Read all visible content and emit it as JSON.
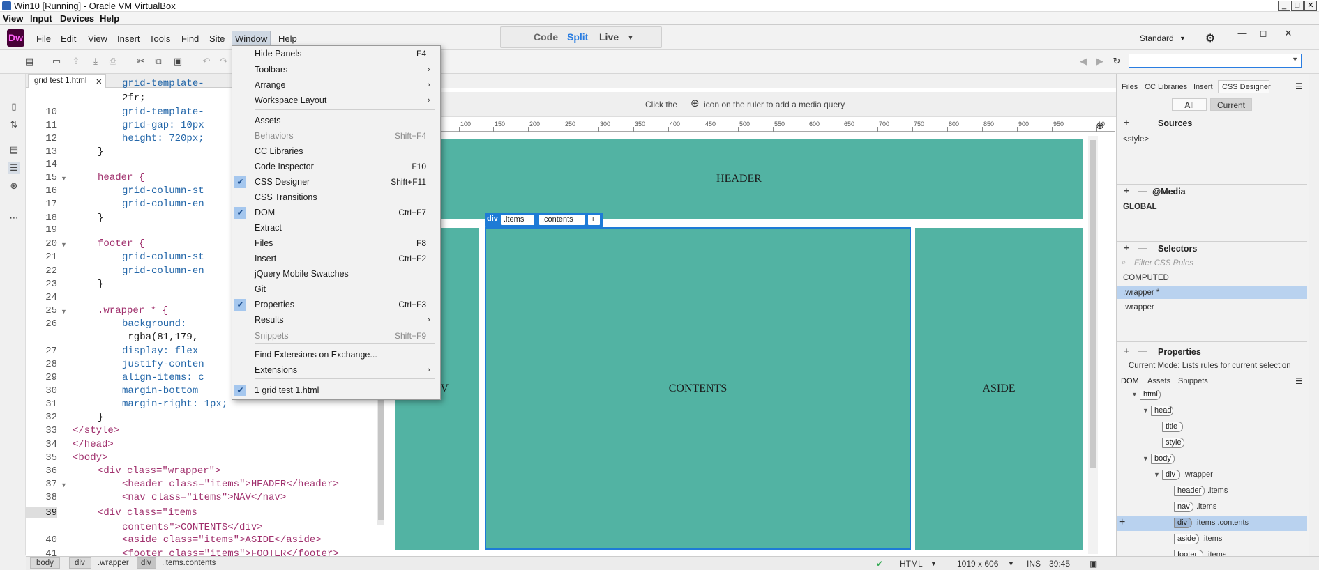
{
  "vbox": {
    "title": "Win10 [Running] - Oracle VM VirtualBox",
    "menu": [
      "View",
      "Input",
      "Devices",
      "Help"
    ]
  },
  "dw": {
    "logo": "Dw",
    "menu": [
      "File",
      "Edit",
      "View",
      "Insert",
      "Tools",
      "Find",
      "Site",
      "Window",
      "Help"
    ],
    "views": {
      "code": "Code",
      "split": "Split",
      "live": "Live"
    },
    "workspace": "Standard"
  },
  "document": {
    "tab": "grid test 1.html"
  },
  "code": {
    "lines": [
      {
        "n": "",
        "text": "grid-template-",
        "cls": "prop"
      },
      {
        "n": "",
        "text": "2fr;"
      },
      {
        "n": "10",
        "text": "grid-template-",
        "cls": "prop"
      },
      {
        "n": "11",
        "text": "grid-gap: 10px",
        "cls": "prop"
      },
      {
        "n": "12",
        "text": "height: 720px;",
        "cls": "prop"
      },
      {
        "n": "13",
        "text": "}"
      },
      {
        "n": "14",
        "text": ""
      },
      {
        "n": "15",
        "text": "header {",
        "cls": "sel"
      },
      {
        "n": "16",
        "text": "grid-column-st",
        "cls": "prop"
      },
      {
        "n": "17",
        "text": "grid-column-en",
        "cls": "prop"
      },
      {
        "n": "18",
        "text": "}"
      },
      {
        "n": "19",
        "text": ""
      },
      {
        "n": "20",
        "text": "footer {",
        "cls": "sel"
      },
      {
        "n": "21",
        "text": "grid-column-st",
        "cls": "prop"
      },
      {
        "n": "22",
        "text": "grid-column-en",
        "cls": "prop"
      },
      {
        "n": "23",
        "text": "}"
      },
      {
        "n": "24",
        "text": ""
      },
      {
        "n": "25",
        "text": ".wrapper * {",
        "cls": "sel"
      },
      {
        "n": "26",
        "text": "background:",
        "cls": "prop"
      },
      {
        "n": "",
        "text": " rgba(81,179,"
      },
      {
        "n": "27",
        "text": "display: flex",
        "cls": "prop"
      },
      {
        "n": "28",
        "text": "justify-conten",
        "cls": "prop"
      },
      {
        "n": "29",
        "text": "align-items: c",
        "cls": "prop"
      },
      {
        "n": "30",
        "text": "margin-bottom",
        "cls": "prop"
      },
      {
        "n": "31",
        "text": "margin-right: 1px;",
        "cls": "prop"
      },
      {
        "n": "32",
        "text": "}"
      },
      {
        "n": "33",
        "text": "</style>",
        "cls": "tag"
      },
      {
        "n": "34",
        "text": "</head>",
        "cls": "tag"
      },
      {
        "n": "35",
        "text": "<body>",
        "cls": "tag"
      },
      {
        "n": "36",
        "text": "<div class=\"wrapper\">",
        "cls": "tag"
      },
      {
        "n": "37",
        "text": "<header class=\"items\">HEADER</header>",
        "cls": "tag"
      },
      {
        "n": "38",
        "text": "<nav class=\"items\">NAV</nav>",
        "cls": "tag"
      },
      {
        "n": "39",
        "text": "<div class=\"items",
        "cls": "tag"
      },
      {
        "n": "",
        "text": "contents\">CONTENTS</div>",
        "cls": "tag"
      },
      {
        "n": "40",
        "text": "<aside class=\"items\">ASIDE</aside>",
        "cls": "tag"
      },
      {
        "n": "41",
        "text": "<footer class=\"items\">FOOTER</footer>",
        "cls": "tag"
      }
    ]
  },
  "live": {
    "mq_hint_pre": "Click the",
    "mq_hint_post": "icon on the ruler to add a media query",
    "ruler": [
      "100",
      "150",
      "200",
      "250",
      "300",
      "350",
      "400",
      "450",
      "500",
      "550",
      "600",
      "650",
      "700",
      "750",
      "800",
      "850",
      "900",
      "950",
      "10"
    ],
    "blocks": {
      "header": "HEADER",
      "nav": "V",
      "contents": "CONTENTS",
      "aside": "ASIDE"
    },
    "hud": {
      "tag": "div",
      "class1": ".items",
      "class2": ".contents",
      "add": "+"
    }
  },
  "window_menu": {
    "items": [
      {
        "label": "Hide Panels",
        "shortcut": "F4"
      },
      {
        "label": "Toolbars",
        "submenu": true
      },
      {
        "label": "Arrange",
        "submenu": true
      },
      {
        "label": "Workspace Layout",
        "submenu": true
      },
      {
        "label": "Assets"
      },
      {
        "label": "Behaviors",
        "shortcut": "Shift+F4",
        "disabled": true
      },
      {
        "label": "CC Libraries"
      },
      {
        "label": "Code Inspector",
        "shortcut": "F10"
      },
      {
        "label": "CSS Designer",
        "shortcut": "Shift+F11",
        "checked": true
      },
      {
        "label": "CSS Transitions"
      },
      {
        "label": "DOM",
        "shortcut": "Ctrl+F7",
        "checked": true
      },
      {
        "label": "Extract"
      },
      {
        "label": "Files",
        "shortcut": "F8"
      },
      {
        "label": "Insert",
        "shortcut": "Ctrl+F2"
      },
      {
        "label": "jQuery Mobile Swatches"
      },
      {
        "label": "Git"
      },
      {
        "label": "Properties",
        "shortcut": "Ctrl+F3",
        "checked": true
      },
      {
        "label": "Results",
        "submenu": true
      },
      {
        "label": "Snippets",
        "shortcut": "Shift+F9",
        "disabled": true
      },
      {
        "label": "Find Extensions on Exchange..."
      },
      {
        "label": "Extensions",
        "submenu": true
      },
      {
        "label": "1 grid test 1.html",
        "checked": true
      }
    ]
  },
  "panels": {
    "tabs": [
      "Files",
      "CC Libraries",
      "Insert",
      "CSS Designer"
    ],
    "modes": {
      "all": "All",
      "current": "Current"
    },
    "sources": {
      "title": "Sources",
      "item": "<style>"
    },
    "media": {
      "title": "@Media",
      "item": "GLOBAL"
    },
    "selectors": {
      "title": "Selectors",
      "filter_placeholder": "Filter CSS Rules",
      "items": [
        "COMPUTED",
        ".wrapper *",
        ".wrapper"
      ]
    },
    "properties": {
      "title": "Properties",
      "mode_text": "Current Mode: Lists rules for current selection"
    },
    "dom_tabs": [
      "DOM",
      "Assets",
      "Snippets"
    ],
    "dom_tree": [
      {
        "tag": "html",
        "cls": ""
      },
      {
        "tag": "head",
        "cls": ""
      },
      {
        "tag": "title",
        "cls": ""
      },
      {
        "tag": "style",
        "cls": ""
      },
      {
        "tag": "body",
        "cls": ""
      },
      {
        "tag": "div",
        "cls": ".wrapper"
      },
      {
        "tag": "header",
        "cls": ".items"
      },
      {
        "tag": "nav",
        "cls": ".items"
      },
      {
        "tag": "div",
        "cls": ".items .contents"
      },
      {
        "tag": "aside",
        "cls": ".items"
      },
      {
        "tag": "footer",
        "cls": ".items"
      }
    ]
  },
  "status": {
    "breadcrumbs": [
      "body",
      "div",
      ".wrapper",
      "div",
      ".items.contents"
    ],
    "lang": "HTML",
    "size": "1019 x 606",
    "mode": "INS",
    "pos": "39:45"
  },
  "colors": {
    "teal": "#52b3a3",
    "selection": "#1e7bd6",
    "dw_brand": "#470137"
  }
}
